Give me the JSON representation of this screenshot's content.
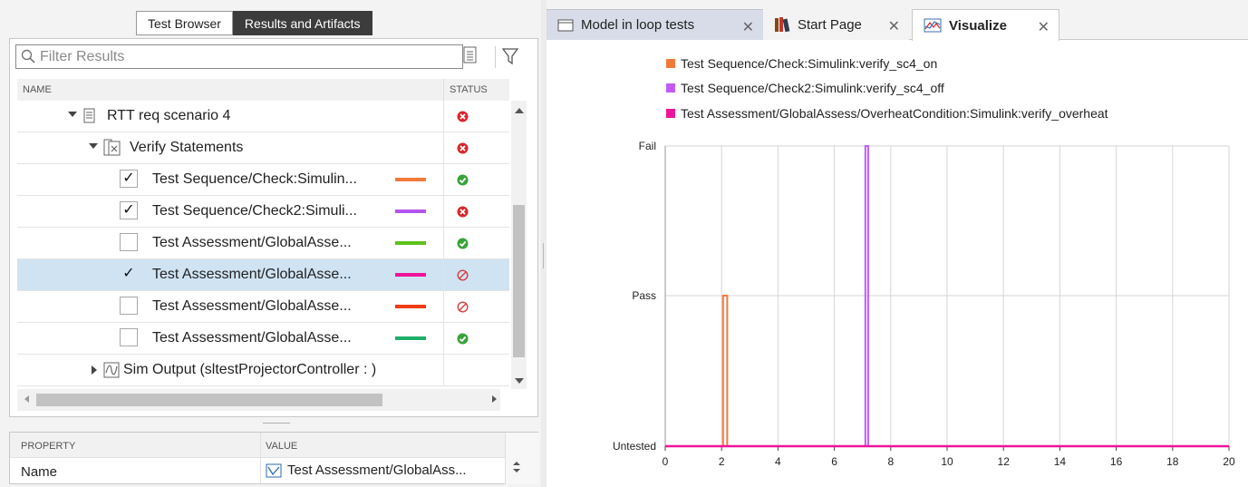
{
  "top_toggle": {
    "test_browser": "Test Browser",
    "results_artifacts": "Results and Artifacts"
  },
  "filter": {
    "placeholder": "Filter Results"
  },
  "columns": {
    "name": "NAME",
    "status": "STATUS"
  },
  "rows": [
    {
      "label": "RTT req scenario 4",
      "status": "fail"
    },
    {
      "label": "Verify Statements",
      "status": "fail"
    },
    {
      "label": "Test Sequence/Check:Simulin...",
      "checked": true,
      "swatch": "#f47a3c",
      "status": "pass"
    },
    {
      "label": "Test Sequence/Check2:Simuli...",
      "checked": true,
      "swatch": "#b355f0",
      "status": "fail"
    },
    {
      "label": "Test Assessment/GlobalAsse...",
      "checked": false,
      "swatch": "#5dc21e",
      "status": "pass"
    },
    {
      "label": "Test Assessment/GlobalAsse...",
      "checked": true,
      "swatch": "#f0149a",
      "status": "untested",
      "selected": true
    },
    {
      "label": "Test Assessment/GlobalAsse...",
      "checked": false,
      "swatch": "#f03c14",
      "status": "untested"
    },
    {
      "label": "Test Assessment/GlobalAsse...",
      "checked": false,
      "swatch": "#1fae6b",
      "status": "pass"
    },
    {
      "label": "Sim Output (sltestProjectorController : )"
    }
  ],
  "check_mark": "✓",
  "properties": {
    "col_property": "PROPERTY",
    "col_value": "VALUE",
    "name_label": "Name",
    "name_value": "Test Assessment/GlobalAss..."
  },
  "tabs": [
    {
      "label": "Model in loop tests",
      "close": "✕"
    },
    {
      "label": "Start Page",
      "close": "✕"
    },
    {
      "label": "Visualize",
      "close": "✕"
    }
  ],
  "colors": {
    "fail": "#d9262c",
    "pass": "#3aa23a",
    "untested": "#d44040"
  },
  "chart_data": {
    "type": "line",
    "step": true,
    "xlim": [
      0,
      20
    ],
    "xticks": [
      0,
      2,
      4,
      6,
      8,
      10,
      12,
      14,
      16,
      18,
      20
    ],
    "ylevels": [
      "Untested",
      "Pass",
      "Fail"
    ],
    "grid": true,
    "legend_position": "top",
    "series": [
      {
        "name": "Test Sequence/Check:Simulink:verify_sc4_on",
        "color": "#f47a3c",
        "points": [
          [
            0,
            "Untested"
          ],
          [
            2.05,
            "Untested"
          ],
          [
            2.05,
            "Pass"
          ],
          [
            2.2,
            "Pass"
          ],
          [
            2.2,
            "Untested"
          ],
          [
            20,
            "Untested"
          ]
        ]
      },
      {
        "name": "Test Sequence/Check2:Simulink:verify_sc4_off",
        "color": "#c05cf5",
        "points": [
          [
            0,
            "Untested"
          ],
          [
            7.1,
            "Untested"
          ],
          [
            7.1,
            "Fail"
          ],
          [
            7.2,
            "Fail"
          ],
          [
            7.2,
            "Untested"
          ],
          [
            20,
            "Untested"
          ]
        ]
      },
      {
        "name": "Test Assessment/GlobalAssess/OverheatCondition:Simulink:verify_overheat",
        "color": "#f0149a",
        "points": [
          [
            0,
            "Untested"
          ],
          [
            20,
            "Untested"
          ]
        ]
      }
    ]
  }
}
